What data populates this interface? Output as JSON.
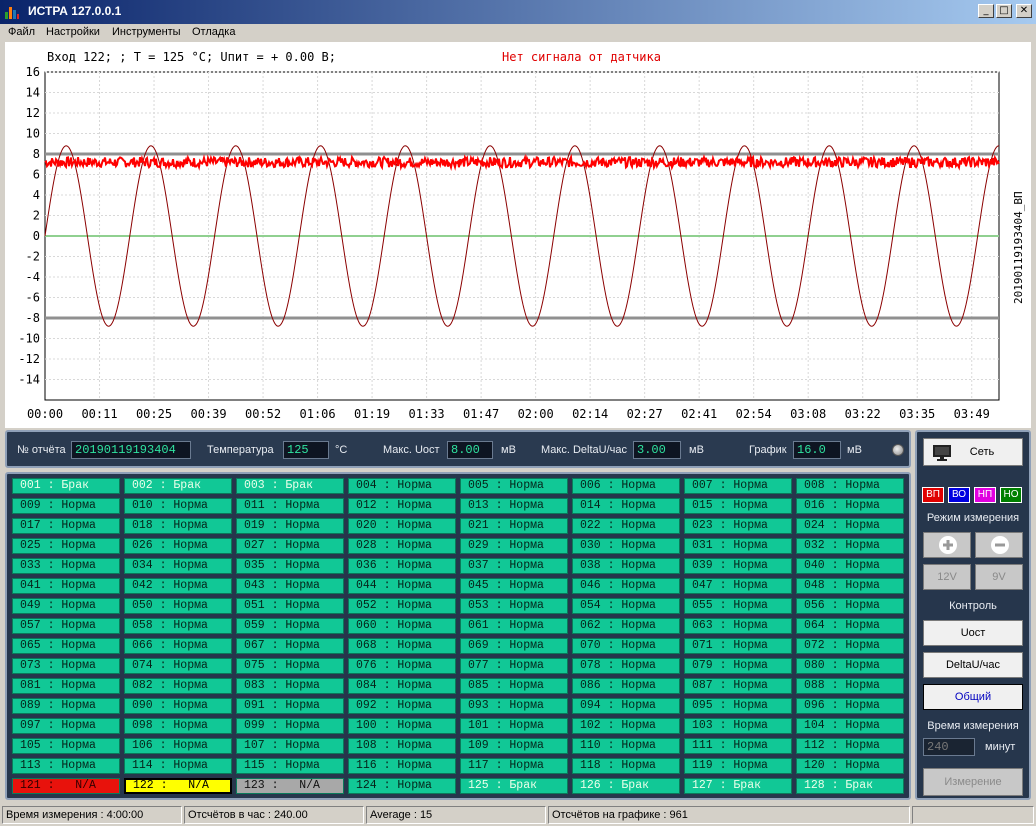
{
  "window": {
    "title": "ИСТРА  127.0.0.1",
    "buttons": {
      "minimize": "_",
      "maximize": "□",
      "close": "✕"
    }
  },
  "menu": [
    "Файл",
    "Настройки",
    "Инструменты",
    "Отладка"
  ],
  "chart": {
    "header_text": "Вход 122; ; T = 125 °C; Uпит = + 0.00 В;",
    "warning_text": "Нет сигнала от датчика",
    "side_label": "20190119193404_ВП",
    "colors": {
      "noise": "#ff0000",
      "sine": "#8b0000",
      "limit": "#909090",
      "zero": "#90d090",
      "warning": "#e00000"
    }
  },
  "chart_data": {
    "type": "line",
    "ylim": [
      -16,
      16
    ],
    "yticks": [
      16,
      14,
      12,
      10,
      8,
      6,
      4,
      2,
      0,
      -2,
      -4,
      -6,
      -8,
      -10,
      -12,
      -14
    ],
    "xticks": [
      "00:00",
      "00:11",
      "00:25",
      "00:39",
      "00:52",
      "01:06",
      "01:19",
      "01:33",
      "01:47",
      "02:00",
      "02:14",
      "02:27",
      "02:41",
      "02:54",
      "03:08",
      "03:22",
      "03:35",
      "03:49"
    ],
    "xlim_minutes": [
      0,
      240
    ],
    "series": [
      {
        "kind": "noise",
        "center": 7.2,
        "noise_amplitude": 0.5
      },
      {
        "kind": "sine",
        "amplitude": 8.8,
        "period_minutes": 21.33,
        "start": 0
      }
    ],
    "limit_lines": [
      8,
      -8
    ],
    "zero_line": 0
  },
  "params": {
    "report_label": "№ отчёта",
    "report_value": "20190119193404",
    "temp_label": "Температура",
    "temp_value": "125",
    "temp_unit": "°C",
    "maxu_label": "Макс. Uост",
    "maxu_value": "8.00",
    "maxu_unit": "мВ",
    "maxdelta_label": "Макс. DeltaU/час",
    "maxdelta_value": "3.00",
    "maxdelta_unit": "мВ",
    "graph_label": "График",
    "graph_value": "16.0",
    "graph_unit": "мВ"
  },
  "cells": [
    "001 : Брак",
    "002 : Брак",
    "003 : Брак",
    "004 : Норма",
    "005 : Норма",
    "006 : Норма",
    "007 : Норма",
    "008 : Норма",
    "009 : Норма",
    "010 : Норма",
    "011 : Норма",
    "012 : Норма",
    "013 : Норма",
    "014 : Норма",
    "015 : Норма",
    "016 : Норма",
    "017 : Норма",
    "018 : Норма",
    "019 : Норма",
    "020 : Норма",
    "021 : Норма",
    "022 : Норма",
    "023 : Норма",
    "024 : Норма",
    "025 : Норма",
    "026 : Норма",
    "027 : Норма",
    "028 : Норма",
    "029 : Норма",
    "030 : Норма",
    "031 : Норма",
    "032 : Норма",
    "033 : Норма",
    "034 : Норма",
    "035 : Норма",
    "036 : Норма",
    "037 : Норма",
    "038 : Норма",
    "039 : Норма",
    "040 : Норма",
    "041 : Норма",
    "042 : Норма",
    "043 : Норма",
    "044 : Норма",
    "045 : Норма",
    "046 : Норма",
    "047 : Норма",
    "048 : Норма",
    "049 : Норма",
    "050 : Норма",
    "051 : Норма",
    "052 : Норма",
    "053 : Норма",
    "054 : Норма",
    "055 : Норма",
    "056 : Норма",
    "057 : Норма",
    "058 : Норма",
    "059 : Норма",
    "060 : Норма",
    "061 : Норма",
    "062 : Норма",
    "063 : Норма",
    "064 : Норма",
    "065 : Норма",
    "066 : Норма",
    "067 : Норма",
    "068 : Норма",
    "069 : Норма",
    "070 : Норма",
    "071 : Норма",
    "072 : Норма",
    "073 : Норма",
    "074 : Норма",
    "075 : Норма",
    "076 : Норма",
    "077 : Норма",
    "078 : Норма",
    "079 : Норма",
    "080 : Норма",
    "081 : Норма",
    "082 : Норма",
    "083 : Норма",
    "084 : Норма",
    "085 : Норма",
    "086 : Норма",
    "087 : Норма",
    "088 : Норма",
    "089 : Норма",
    "090 : Норма",
    "091 : Норма",
    "092 : Норма",
    "093 : Норма",
    "094 : Норма",
    "095 : Норма",
    "096 : Норма",
    "097 : Норма",
    "098 : Норма",
    "099 : Норма",
    "100 : Норма",
    "101 : Норма",
    "102 : Норма",
    "103 : Норма",
    "104 : Норма",
    "105 : Норма",
    "106 : Норма",
    "107 : Норма",
    "108 : Норма",
    "109 : Норма",
    "110 : Норма",
    "111 : Норма",
    "112 : Норма",
    "113 : Норма",
    "114 : Норма",
    "115 : Норма",
    "116 : Норма",
    "117 : Норма",
    "118 : Норма",
    "119 : Норма",
    "120 : Норма",
    "121 :   N/A",
    "122 :   N/A",
    "123 :   N/A",
    "124 : Норма",
    "125 : Брак",
    "126 : Брак",
    "127 : Брак",
    "128 : Брак"
  ],
  "cell_styles": {
    "0": "brak",
    "1": "brak",
    "2": "brak",
    "120": "na-red",
    "121": "na-yellow",
    "122": "na-gray",
    "124": "brak",
    "125": "brak",
    "126": "brak",
    "127": "brak"
  },
  "side": {
    "network_label": "Сеть",
    "mode_boxes": [
      {
        "label": "ВП",
        "bg": "#e00000"
      },
      {
        "label": "ВО",
        "bg": "#0000e0"
      },
      {
        "label": "НП",
        "bg": "#e000e0"
      },
      {
        "label": "НО",
        "bg": "#008000"
      }
    ],
    "mode_title": "Режим измерения",
    "plus": "+",
    "minus": "−",
    "v12": "12V",
    "v9": "9V",
    "control_title": "Контроль",
    "uost": "Uост",
    "deltau": "DeltaU/час",
    "common": "Общий",
    "time_title": "Время измерения",
    "time_value": "240",
    "time_unit": "минут",
    "measure": "Измерение"
  },
  "status": {
    "time": "Время измерения : 4:00:00",
    "per_hour": "Отсчётов в час : 240.00",
    "average": "Average : 15",
    "on_graph": "Отсчётов на графике : 961"
  }
}
